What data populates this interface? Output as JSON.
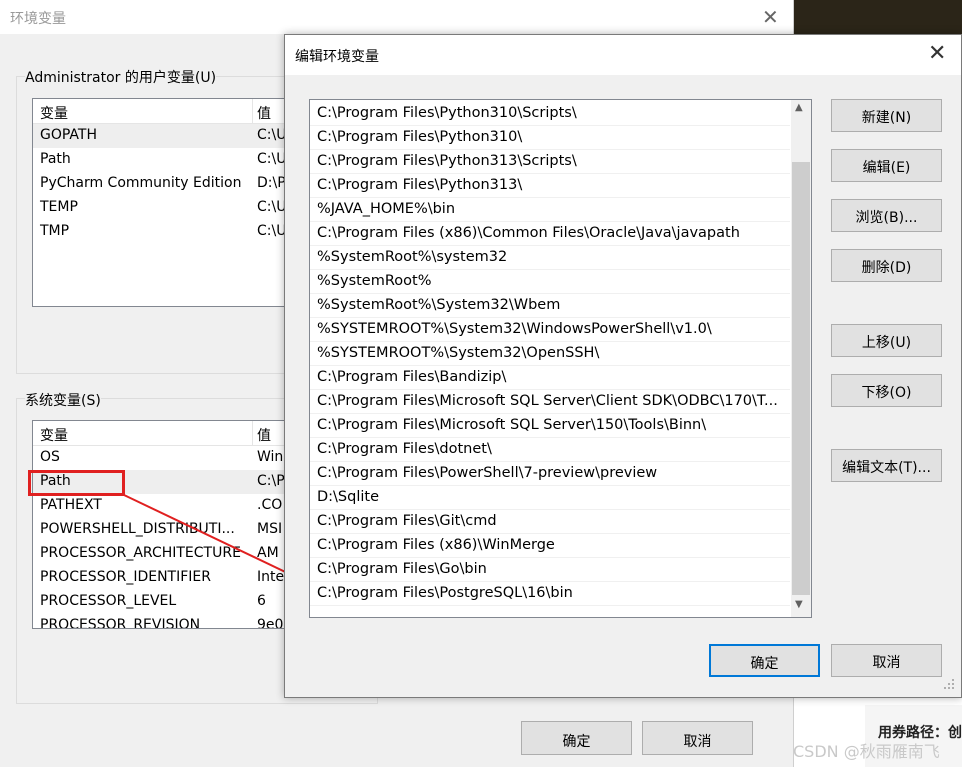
{
  "parent": {
    "title": "环境变量",
    "user_group_label": "Administrator 的用户变量(U)",
    "user_headers": [
      "变量",
      "值"
    ],
    "user_rows": [
      {
        "name": "GOPATH",
        "value": "C:\\U"
      },
      {
        "name": "Path",
        "value": "C:\\U"
      },
      {
        "name": "PyCharm Community Edition",
        "value": "D:\\P"
      },
      {
        "name": "TEMP",
        "value": "C:\\U"
      },
      {
        "name": "TMP",
        "value": "C:\\U"
      }
    ],
    "system_group_label": "系统变量(S)",
    "system_headers": [
      "变量",
      "值"
    ],
    "system_rows": [
      {
        "name": "OS",
        "value": "Win"
      },
      {
        "name": "Path",
        "value": "C:\\P"
      },
      {
        "name": "PATHEXT",
        "value": ".CO"
      },
      {
        "name": "POWERSHELL_DISTRIBUTI...",
        "value": "MSI"
      },
      {
        "name": "PROCESSOR_ARCHITECTURE",
        "value": "AM"
      },
      {
        "name": "PROCESSOR_IDENTIFIER",
        "value": "Inte"
      },
      {
        "name": "PROCESSOR_LEVEL",
        "value": "6"
      },
      {
        "name": "PROCESSOR_REVISION",
        "value": "9e0"
      }
    ],
    "ok_label": "确定",
    "cancel_label": "取消"
  },
  "dialog": {
    "title": "编辑环境变量",
    "paths": [
      "C:\\Program Files\\Python310\\Scripts\\",
      "C:\\Program Files\\Python310\\",
      "C:\\Program Files\\Python313\\Scripts\\",
      "C:\\Program Files\\Python313\\",
      "%JAVA_HOME%\\bin",
      "C:\\Program Files (x86)\\Common Files\\Oracle\\Java\\javapath",
      "%SystemRoot%\\system32",
      "%SystemRoot%",
      "%SystemRoot%\\System32\\Wbem",
      "%SYSTEMROOT%\\System32\\WindowsPowerShell\\v1.0\\",
      "%SYSTEMROOT%\\System32\\OpenSSH\\",
      "C:\\Program Files\\Bandizip\\",
      "C:\\Program Files\\Microsoft SQL Server\\Client SDK\\ODBC\\170\\T...",
      "C:\\Program Files\\Microsoft SQL Server\\150\\Tools\\Binn\\",
      "C:\\Program Files\\dotnet\\",
      "C:\\Program Files\\PowerShell\\7-preview\\preview",
      "D:\\Sqlite",
      "C:\\Program Files\\Git\\cmd",
      "C:\\Program Files (x86)\\WinMerge",
      "C:\\Program Files\\Go\\bin",
      "C:\\Program Files\\PostgreSQL\\16\\bin"
    ],
    "buttons": {
      "new": "新建(N)",
      "edit": "编辑(E)",
      "browse": "浏览(B)...",
      "delete": "删除(D)",
      "move_up": "上移(U)",
      "move_down": "下移(O)",
      "edit_text": "编辑文本(T)..."
    },
    "ok_label": "确定",
    "cancel_label": "取消"
  },
  "background": {
    "hint": "用券路径：创",
    "watermark": "CSDN @秋雨雁南飞"
  },
  "colors": {
    "annotation": "#e02020",
    "accent": "#0078d7"
  }
}
